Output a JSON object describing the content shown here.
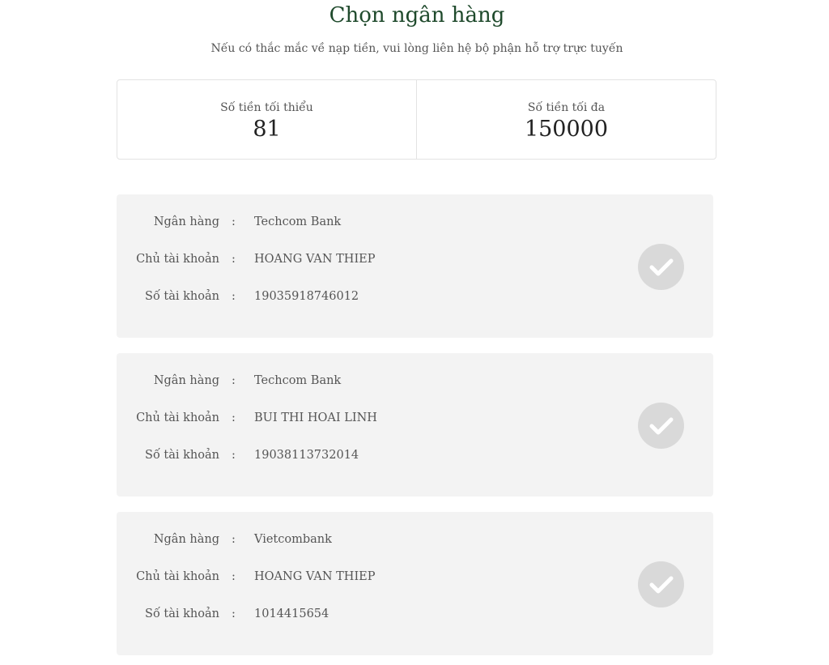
{
  "header": {
    "title": "Chọn ngân hàng",
    "subtitle": "Nếu có thắc mắc về nạp tiền, vui lòng liên hệ bộ phận hỗ trợ trực tuyến"
  },
  "limits": {
    "min_label": "Số tiền tối thiểu",
    "min_value": "81",
    "max_label": "Số tiền tối đa",
    "max_value": "150000"
  },
  "labels": {
    "bank": "Ngân hàng",
    "owner": "Chủ tài khoản",
    "account": "Số tài khoản",
    "separator": ":"
  },
  "banks": [
    {
      "bank": "Techcom Bank",
      "owner": "HOANG VAN THIEP",
      "account": "19035918746012",
      "selected_icon": "check-icon"
    },
    {
      "bank": "Techcom Bank",
      "owner": "BUI THI HOAI LINH",
      "account": "19038113732014",
      "selected_icon": "check-icon"
    },
    {
      "bank": "Vietcombank",
      "owner": "HOANG VAN THIEP",
      "account": "1014415654",
      "selected_icon": "check-icon"
    }
  ],
  "colors": {
    "title": "#1f4a2c",
    "card_bg": "#f3f3f3",
    "check_bg": "#d9d9d9",
    "check_mark": "#ffffff"
  }
}
